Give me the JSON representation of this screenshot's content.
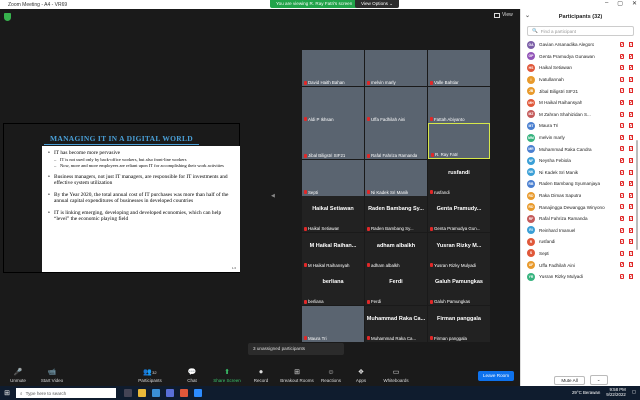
{
  "window": {
    "title": "Zoom Meeting - A4 - VR69"
  },
  "banner": {
    "viewing": "You are viewing R. Ray Fatri's screen",
    "view_options": "View Options ⌄"
  },
  "view_label": "View",
  "slide": {
    "title": "MANAGING IT IN A DIGITAL WORLD",
    "bullet1": "IT has become more pervasive",
    "sub1": "IT is not used only by back-office workers, but also front-line workers",
    "sub2": "Now, more and more employees are reliant upon IT for accomplishing their work activities",
    "bullet2": "Business managers, not just IT managers, are responsible for IT investments and effective system utilization",
    "bullet3": "By the Year 2020,  the total annual cost of IT purchases was more than half of the annual capital expenditures of businesses in developed countries",
    "bullet4": "IT is linking emerging, developing and developed economies, which can help “level” the economic playing field",
    "page": "1-5"
  },
  "gallery": [
    {
      "name": "David Haith Bahan",
      "big": ""
    },
    {
      "name": "melvin marly",
      "big": ""
    },
    {
      "name": "Valle Bahtiar",
      "big": ""
    },
    {
      "name": "Aldi P Ikhsan",
      "big": ""
    },
    {
      "name": "Uffa Fadhilah Aini",
      "big": ""
    },
    {
      "name": "Fattah Abiyanto",
      "big": ""
    },
    {
      "name": "Jibal Biligstri SIF21",
      "big": ""
    },
    {
      "name": "Rafal Fahriza Ramanda",
      "big": ""
    },
    {
      "name": "R. Ray Fatri",
      "big": ""
    },
    {
      "name": "Septi",
      "big": ""
    },
    {
      "name": "Ni Kadek Sri Manik",
      "big": ""
    },
    {
      "name": "rusfandi",
      "big": "rusfandi"
    },
    {
      "name": "Haikal Setiawan",
      "big": "Haikal Setiawan"
    },
    {
      "name": "Raden Bambang Sy...",
      "big": "Raden Bambang Sy..."
    },
    {
      "name": "Genta Pramudya Gun...",
      "big": "Genta Pramudy..."
    },
    {
      "name": "M Haikal Raihansyah",
      "big": "M Haikal Raihan..."
    },
    {
      "name": "adham albalkh",
      "big": "adham albalkh"
    },
    {
      "name": "Yusran Rizky Mulyadi",
      "big": "Yusran Rizky M..."
    },
    {
      "name": "berliana",
      "big": "berliana"
    },
    {
      "name": "Ferdi",
      "big": "Ferdi"
    },
    {
      "name": "Galuh Pamungkas",
      "big": "Galuh Pamungkas"
    },
    {
      "name": "Maura Tri",
      "big": ""
    },
    {
      "name": "Muhammad Raka Ca...",
      "big": "Muhammad Raka Ca..."
    },
    {
      "name": "Firman panggala",
      "big": "Firman panggala"
    }
  ],
  "unassigned": "3 unassigned participants",
  "toolbar": {
    "unmute": "Unmute",
    "start_video": "Start Video",
    "participants": "Participants",
    "participants_count": "32",
    "chat": "Chat",
    "share": "Share Screen",
    "record": "Record",
    "breakout": "Breakout Rooms",
    "reactions": "Reactions",
    "apps": "Apps",
    "whiteboards": "Whiteboards",
    "leave": "Leave Room"
  },
  "panel": {
    "title": "Participants (32)",
    "search_placeholder": "Find a participant",
    "mute_all": "Mute All",
    "participants": [
      {
        "initials": "GA",
        "name": "Gavian Arsanadika Alegoro",
        "color": "#7b5ea7"
      },
      {
        "initials": "GP",
        "name": "Genta Pramudya Gunawan",
        "color": "#9254b8"
      },
      {
        "initials": "HS",
        "name": "Haikal Setiawan",
        "color": "#e0583a"
      },
      {
        "initials": "I",
        "name": "Ivatullannah",
        "color": "#e89a2c"
      },
      {
        "initials": "JB",
        "name": "Jibal Biligstri SIF21",
        "color": "#e89a2c"
      },
      {
        "initials": "MH",
        "name": "M Haikal Raihansyah",
        "color": "#e0583a"
      },
      {
        "initials": "MZ",
        "name": "M Zahran Shahizidan S...",
        "color": "#c45a5a"
      },
      {
        "initials": "MT",
        "name": "Maura Tri",
        "color": "#4a7fd0"
      },
      {
        "initials": "MM",
        "name": "melvin marly",
        "color": "#36b37e"
      },
      {
        "initials": "MR",
        "name": "Muhammad Raka Candra",
        "color": "#4a7fd0"
      },
      {
        "initials": "NF",
        "name": "Neysha Febiola",
        "color": "#3a9fd6"
      },
      {
        "initials": "NK",
        "name": "Ni Kadek Sri Manik",
        "color": "#3a9fd6"
      },
      {
        "initials": "RB",
        "name": "Raden Bambang Syumanjaya",
        "color": "#4a7fd0"
      },
      {
        "initials": "RD",
        "name": "Raka Dimas Saputra",
        "color": "#e89a2c"
      },
      {
        "initials": "RD",
        "name": "Ranajingga Dewangga Winyono",
        "color": "#e89a2c"
      },
      {
        "initials": "RF",
        "name": "Rafal Fahriza Ramanda",
        "color": "#c45a5a"
      },
      {
        "initials": "RI",
        "name": "Reinhard Imanuel",
        "color": "#3a9fd6"
      },
      {
        "initials": "R",
        "name": "rusfandi",
        "color": "#e0583a"
      },
      {
        "initials": "S",
        "name": "Septi",
        "color": "#e0583a"
      },
      {
        "initials": "UF",
        "name": "Uffa Fadhilah Aini",
        "color": "#e89a2c"
      },
      {
        "initials": "YR",
        "name": "Yusran Rizky Mulyadi",
        "color": "#36b37e"
      }
    ]
  },
  "taskbar": {
    "search_placeholder": "Type here to search",
    "weather": "29°C Berawan",
    "time": "9:58 PM",
    "date": "9/22/2022"
  }
}
